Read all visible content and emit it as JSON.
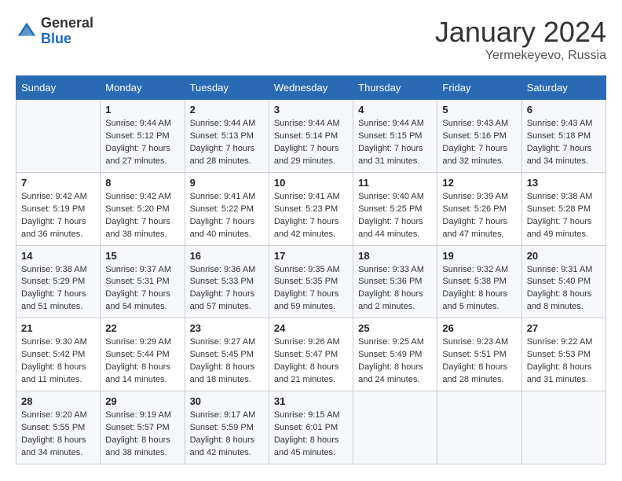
{
  "header": {
    "logo_general": "General",
    "logo_blue": "Blue",
    "month": "January 2024",
    "location": "Yermekeyevo, Russia"
  },
  "weekdays": [
    "Sunday",
    "Monday",
    "Tuesday",
    "Wednesday",
    "Thursday",
    "Friday",
    "Saturday"
  ],
  "weeks": [
    [
      {
        "day": "",
        "info": ""
      },
      {
        "day": "1",
        "info": "Sunrise: 9:44 AM\nSunset: 5:12 PM\nDaylight: 7 hours\nand 27 minutes."
      },
      {
        "day": "2",
        "info": "Sunrise: 9:44 AM\nSunset: 5:13 PM\nDaylight: 7 hours\nand 28 minutes."
      },
      {
        "day": "3",
        "info": "Sunrise: 9:44 AM\nSunset: 5:14 PM\nDaylight: 7 hours\nand 29 minutes."
      },
      {
        "day": "4",
        "info": "Sunrise: 9:44 AM\nSunset: 5:15 PM\nDaylight: 7 hours\nand 31 minutes."
      },
      {
        "day": "5",
        "info": "Sunrise: 9:43 AM\nSunset: 5:16 PM\nDaylight: 7 hours\nand 32 minutes."
      },
      {
        "day": "6",
        "info": "Sunrise: 9:43 AM\nSunset: 5:18 PM\nDaylight: 7 hours\nand 34 minutes."
      }
    ],
    [
      {
        "day": "7",
        "info": "Sunrise: 9:42 AM\nSunset: 5:19 PM\nDaylight: 7 hours\nand 36 minutes."
      },
      {
        "day": "8",
        "info": "Sunrise: 9:42 AM\nSunset: 5:20 PM\nDaylight: 7 hours\nand 38 minutes."
      },
      {
        "day": "9",
        "info": "Sunrise: 9:41 AM\nSunset: 5:22 PM\nDaylight: 7 hours\nand 40 minutes."
      },
      {
        "day": "10",
        "info": "Sunrise: 9:41 AM\nSunset: 5:23 PM\nDaylight: 7 hours\nand 42 minutes."
      },
      {
        "day": "11",
        "info": "Sunrise: 9:40 AM\nSunset: 5:25 PM\nDaylight: 7 hours\nand 44 minutes."
      },
      {
        "day": "12",
        "info": "Sunrise: 9:39 AM\nSunset: 5:26 PM\nDaylight: 7 hours\nand 47 minutes."
      },
      {
        "day": "13",
        "info": "Sunrise: 9:38 AM\nSunset: 5:28 PM\nDaylight: 7 hours\nand 49 minutes."
      }
    ],
    [
      {
        "day": "14",
        "info": "Sunrise: 9:38 AM\nSunset: 5:29 PM\nDaylight: 7 hours\nand 51 minutes."
      },
      {
        "day": "15",
        "info": "Sunrise: 9:37 AM\nSunset: 5:31 PM\nDaylight: 7 hours\nand 54 minutes."
      },
      {
        "day": "16",
        "info": "Sunrise: 9:36 AM\nSunset: 5:33 PM\nDaylight: 7 hours\nand 57 minutes."
      },
      {
        "day": "17",
        "info": "Sunrise: 9:35 AM\nSunset: 5:35 PM\nDaylight: 7 hours\nand 59 minutes."
      },
      {
        "day": "18",
        "info": "Sunrise: 9:33 AM\nSunset: 5:36 PM\nDaylight: 8 hours\nand 2 minutes."
      },
      {
        "day": "19",
        "info": "Sunrise: 9:32 AM\nSunset: 5:38 PM\nDaylight: 8 hours\nand 5 minutes."
      },
      {
        "day": "20",
        "info": "Sunrise: 9:31 AM\nSunset: 5:40 PM\nDaylight: 8 hours\nand 8 minutes."
      }
    ],
    [
      {
        "day": "21",
        "info": "Sunrise: 9:30 AM\nSunset: 5:42 PM\nDaylight: 8 hours\nand 11 minutes."
      },
      {
        "day": "22",
        "info": "Sunrise: 9:29 AM\nSunset: 5:44 PM\nDaylight: 8 hours\nand 14 minutes."
      },
      {
        "day": "23",
        "info": "Sunrise: 9:27 AM\nSunset: 5:45 PM\nDaylight: 8 hours\nand 18 minutes."
      },
      {
        "day": "24",
        "info": "Sunrise: 9:26 AM\nSunset: 5:47 PM\nDaylight: 8 hours\nand 21 minutes."
      },
      {
        "day": "25",
        "info": "Sunrise: 9:25 AM\nSunset: 5:49 PM\nDaylight: 8 hours\nand 24 minutes."
      },
      {
        "day": "26",
        "info": "Sunrise: 9:23 AM\nSunset: 5:51 PM\nDaylight: 8 hours\nand 28 minutes."
      },
      {
        "day": "27",
        "info": "Sunrise: 9:22 AM\nSunset: 5:53 PM\nDaylight: 8 hours\nand 31 minutes."
      }
    ],
    [
      {
        "day": "28",
        "info": "Sunrise: 9:20 AM\nSunset: 5:55 PM\nDaylight: 8 hours\nand 34 minutes."
      },
      {
        "day": "29",
        "info": "Sunrise: 9:19 AM\nSunset: 5:57 PM\nDaylight: 8 hours\nand 38 minutes."
      },
      {
        "day": "30",
        "info": "Sunrise: 9:17 AM\nSunset: 5:59 PM\nDaylight: 8 hours\nand 42 minutes."
      },
      {
        "day": "31",
        "info": "Sunrise: 9:15 AM\nSunset: 6:01 PM\nDaylight: 8 hours\nand 45 minutes."
      },
      {
        "day": "",
        "info": ""
      },
      {
        "day": "",
        "info": ""
      },
      {
        "day": "",
        "info": ""
      }
    ]
  ]
}
